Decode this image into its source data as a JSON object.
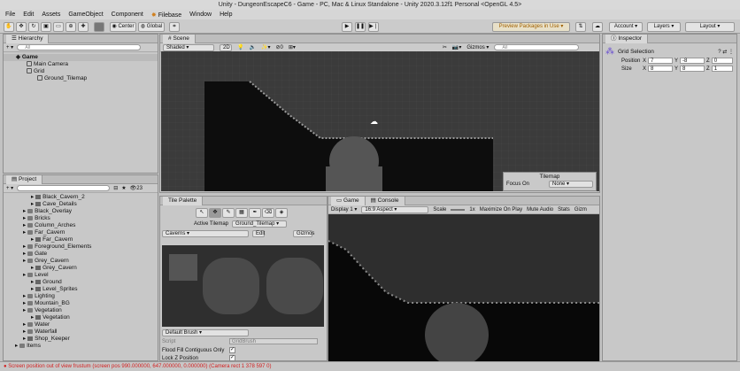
{
  "window_title": "Unity - DungeonEscapeC6 - Game - PC, Mac & Linux Standalone - Unity 2020.3.12f1 Personal <OpenGL 4.5>",
  "menu": [
    "File",
    "Edit",
    "Assets",
    "GameObject",
    "Component",
    "Filebase",
    "Window",
    "Help"
  ],
  "toolbar": {
    "center": "Center",
    "global": "Global",
    "preview_packages": "Preview Packages in Use",
    "account": "Account",
    "layers": "Layers",
    "layout": "Layout"
  },
  "hierarchy": {
    "tab": "Hierarchy",
    "search_placeholder": "All",
    "items": [
      {
        "label": "Game",
        "depth": 0,
        "bold": true
      },
      {
        "label": "Main Camera",
        "depth": 1
      },
      {
        "label": "Grid",
        "depth": 1
      },
      {
        "label": "Ground_Tilemap",
        "depth": 2
      }
    ]
  },
  "project": {
    "tab": "Project",
    "count": "23",
    "items": [
      {
        "label": "Black_Cavern_2",
        "depth": 3,
        "type": "asset"
      },
      {
        "label": "Cave_Details",
        "depth": 3,
        "type": "asset"
      },
      {
        "label": "Black_Overlay",
        "depth": 2,
        "type": "folder"
      },
      {
        "label": "Bricks",
        "depth": 2,
        "type": "folder"
      },
      {
        "label": "Column_Arches",
        "depth": 2,
        "type": "folder"
      },
      {
        "label": "Far_Cavern",
        "depth": 2,
        "type": "folder"
      },
      {
        "label": "Far_Cavern",
        "depth": 3,
        "type": "asset"
      },
      {
        "label": "Foreground_Elements",
        "depth": 2,
        "type": "folder"
      },
      {
        "label": "Gate",
        "depth": 2,
        "type": "folder"
      },
      {
        "label": "Grey_Cavern",
        "depth": 2,
        "type": "folder"
      },
      {
        "label": "Grey_Cavern",
        "depth": 3,
        "type": "asset"
      },
      {
        "label": "Level",
        "depth": 2,
        "type": "folder"
      },
      {
        "label": "Ground",
        "depth": 3,
        "type": "asset"
      },
      {
        "label": "Level_Sprites",
        "depth": 3,
        "type": "asset"
      },
      {
        "label": "Lighting",
        "depth": 2,
        "type": "folder"
      },
      {
        "label": "Mountain_BG",
        "depth": 2,
        "type": "folder"
      },
      {
        "label": "Vegetation",
        "depth": 2,
        "type": "folder"
      },
      {
        "label": "Vegetation",
        "depth": 3,
        "type": "asset"
      },
      {
        "label": "Water",
        "depth": 2,
        "type": "folder"
      },
      {
        "label": "Waterfall",
        "depth": 2,
        "type": "folder"
      },
      {
        "label": "Shop_Keeper",
        "depth": 2,
        "type": "asset"
      },
      {
        "label": "Items",
        "depth": 1,
        "type": "folder"
      }
    ]
  },
  "scene": {
    "tab": "Scene",
    "shading": "Shaded",
    "mode_2d": "2D",
    "gizmos": "Gizmos",
    "search_placeholder": "All",
    "hidden_count": "0"
  },
  "tilemap_overlay": {
    "title": "Tilemap",
    "focus_label": "Focus On",
    "focus_value": "None"
  },
  "tile_palette": {
    "tab": "Tile Palette",
    "active_tilemap_label": "Active Tilemap",
    "active_tilemap_value": "Ground_Tilemap",
    "palette": "Caverns",
    "edit": "Edit",
    "gizmos": "Gizmos",
    "brush": "Default Brush",
    "script_label": "Script",
    "script_value": "GridBrush",
    "flood_fill_label": "Flood Fill Contiguous Only",
    "lock_z_label": "Lock Z Position"
  },
  "game": {
    "tab": "Game",
    "console_tab": "Console",
    "display": "Display 1",
    "aspect": "16:9 Aspect",
    "scale_label": "Scale",
    "scale_value": "1x",
    "maximize": "Maximize On Play",
    "mute": "Mute Audio",
    "stats": "Stats",
    "gizmos": "Gizm"
  },
  "inspector": {
    "tab": "Inspector",
    "object": "Grid Selection",
    "position_label": "Position",
    "size_label": "Size",
    "position": {
      "x": "7",
      "y": "-8",
      "z": "0"
    },
    "size": {
      "x": "8",
      "y": "8",
      "z": "1"
    }
  },
  "status": "Screen position out of view frustum (screen pos 990.000000, 647.000000, 0.000000) (Camera rect 1 378 597 0)",
  "colors": {
    "error": "#d32020",
    "selection": "#3a72d8"
  }
}
